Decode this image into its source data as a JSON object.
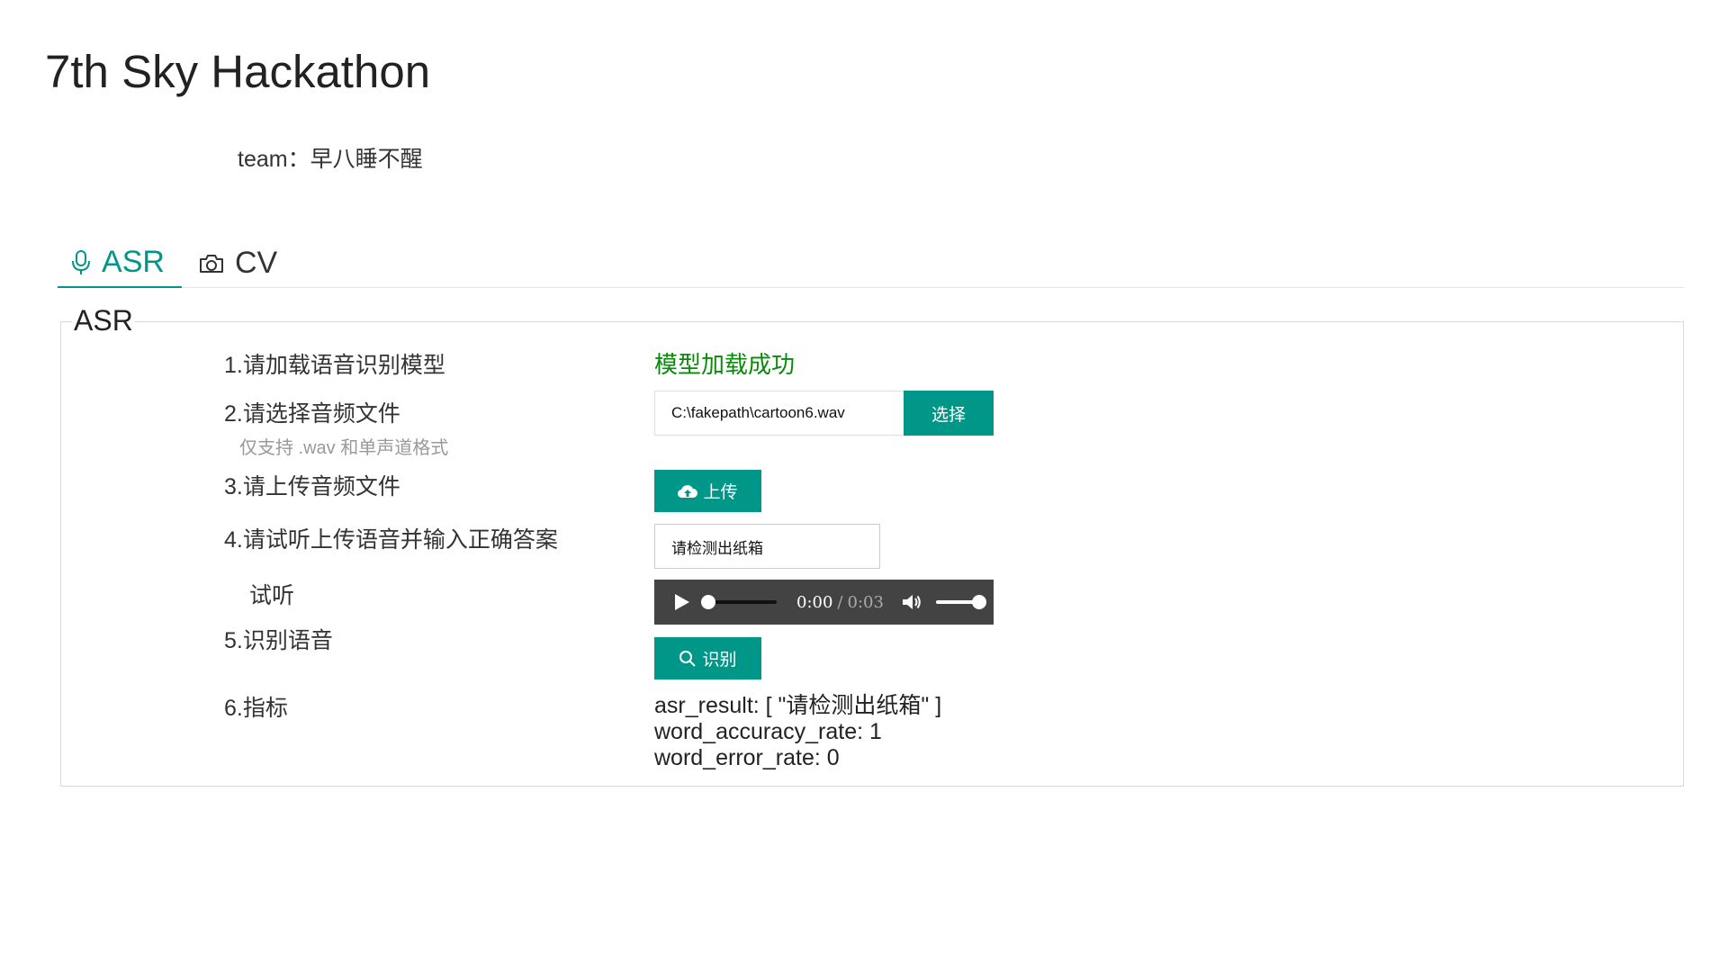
{
  "page": {
    "title": "7th Sky Hackathon",
    "team_label": "team：",
    "team_name": "早八睡不醒"
  },
  "tabs": [
    {
      "label": "ASR",
      "icon": "microphone-icon",
      "active": true
    },
    {
      "label": "CV",
      "icon": "camera-icon",
      "active": false
    }
  ],
  "panel": {
    "legend": "ASR",
    "steps": {
      "load_model": "1.请加载语音识别模型",
      "select_file": "2.请选择音频文件",
      "select_hint": "仅支持 .wav 和单声道格式",
      "upload_file": "3.请上传音频文件",
      "listen_and_answer": "4.请试听上传语音并输入正确答案",
      "listen": "试听",
      "recognize": "5.识别语音",
      "metrics": "6.指标"
    },
    "model_status": "模型加载成功",
    "file_path": "C:\\fakepath\\cartoon6.wav",
    "choose_button": "选择",
    "upload_button": "上传",
    "answer_value": "请检测出纸箱",
    "audio": {
      "current_time": "0:00",
      "separator": "/",
      "duration": "0:03",
      "progress_fraction": 0,
      "volume_fraction": 1
    },
    "recognize_button": "识别",
    "result": {
      "asr_result": "asr_result: [ \"请检测出纸箱\" ]",
      "word_accuracy_rate": "word_accuracy_rate: 1",
      "word_error_rate": "word_error_rate: 0"
    }
  },
  "colors": {
    "accent": "#009688",
    "success": "#0a8a0a",
    "player_bg": "#434343"
  }
}
